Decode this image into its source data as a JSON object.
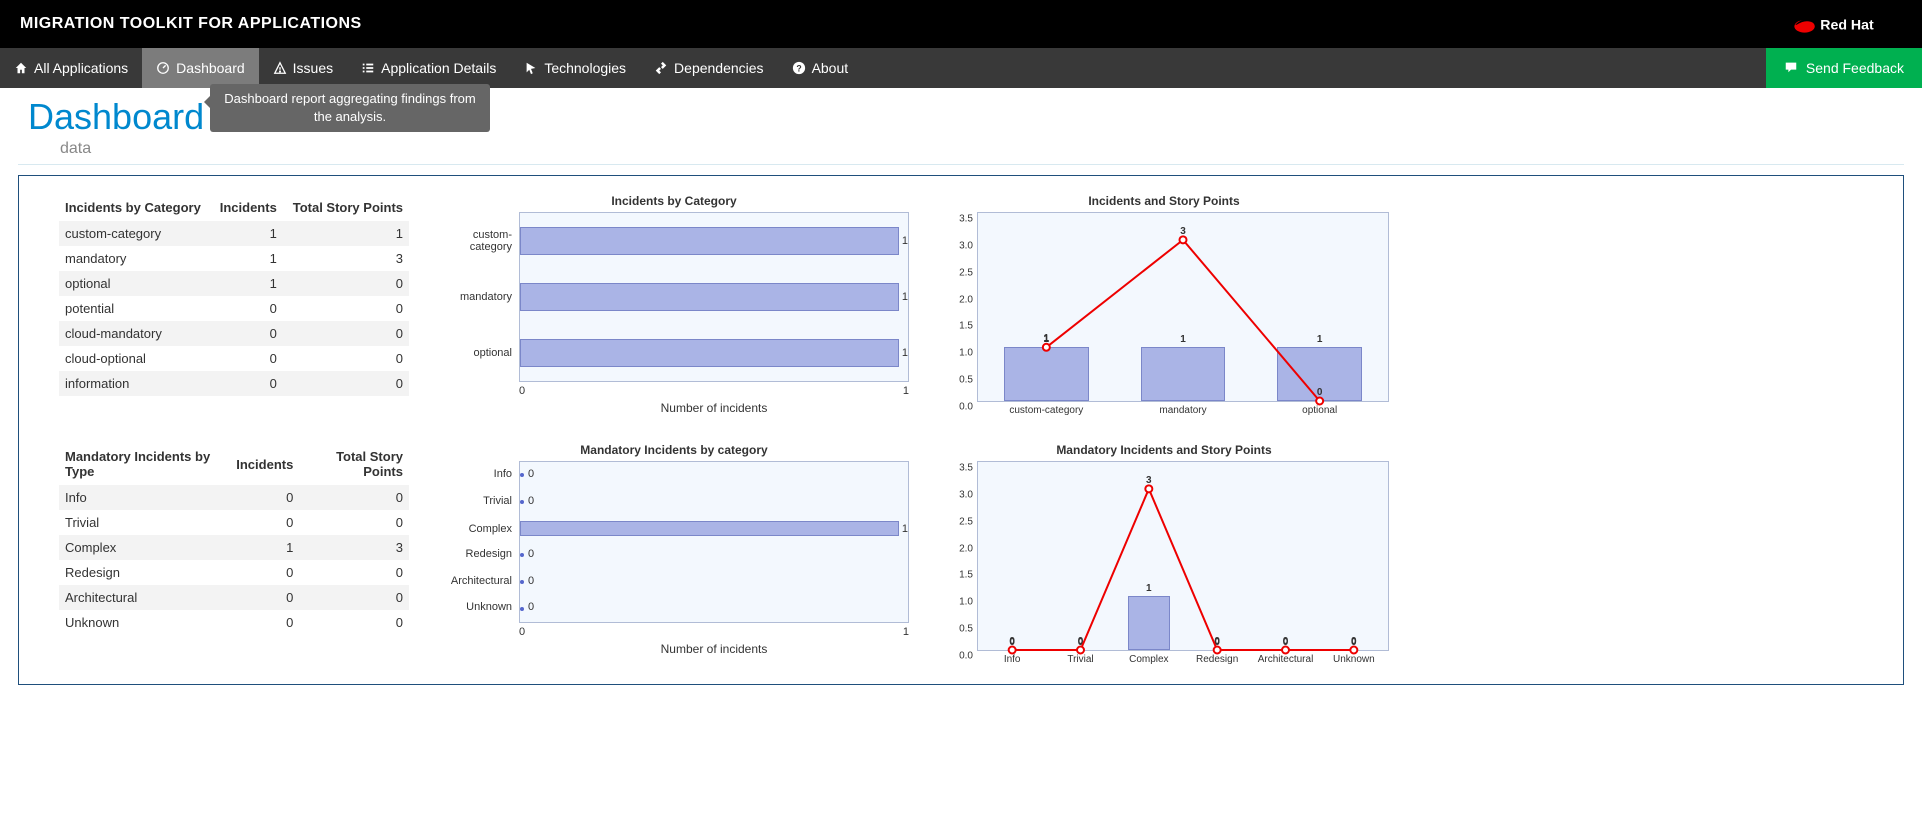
{
  "header": {
    "app_title": "MIGRATION TOOLKIT FOR APPLICATIONS",
    "brand": "Red Hat"
  },
  "nav": {
    "all_apps": "All Applications",
    "dashboard": "Dashboard",
    "issues": "Issues",
    "app_details": "Application Details",
    "technologies": "Technologies",
    "dependencies": "Dependencies",
    "about": "About",
    "feedback": "Send Feedback"
  },
  "page": {
    "title": "Dashboard",
    "tooltip": "Dashboard report aggregating findings from the analysis.",
    "subtitle": "data"
  },
  "tables": {
    "t1": {
      "headers": [
        "Incidents by Category",
        "Incidents",
        "Total Story Points"
      ],
      "rows": [
        {
          "c0": "custom-category",
          "c1": "1",
          "c2": "1"
        },
        {
          "c0": "mandatory",
          "c1": "1",
          "c2": "3"
        },
        {
          "c0": "optional",
          "c1": "1",
          "c2": "0"
        },
        {
          "c0": "potential",
          "c1": "0",
          "c2": "0"
        },
        {
          "c0": "cloud-mandatory",
          "c1": "0",
          "c2": "0"
        },
        {
          "c0": "cloud-optional",
          "c1": "0",
          "c2": "0"
        },
        {
          "c0": "information",
          "c1": "0",
          "c2": "0"
        }
      ]
    },
    "t2": {
      "headers": [
        "Mandatory Incidents by Type",
        "Incidents",
        "Total Story Points"
      ],
      "rows": [
        {
          "c0": "Info",
          "c1": "0",
          "c2": "0"
        },
        {
          "c0": "Trivial",
          "c1": "0",
          "c2": "0"
        },
        {
          "c0": "Complex",
          "c1": "1",
          "c2": "3"
        },
        {
          "c0": "Redesign",
          "c1": "0",
          "c2": "0"
        },
        {
          "c0": "Architectural",
          "c1": "0",
          "c2": "0"
        },
        {
          "c0": "Unknown",
          "c1": "0",
          "c2": "0"
        }
      ]
    }
  },
  "chart_data": [
    {
      "id": "chart1",
      "type": "bar",
      "orientation": "horizontal",
      "title": "Incidents by Category",
      "xlabel": "Number of incidents",
      "categories": [
        "custom-category",
        "mandatory",
        "optional"
      ],
      "values": [
        1,
        1,
        1
      ],
      "xlim": [
        0,
        1
      ]
    },
    {
      "id": "chart2",
      "type": "bar+line",
      "title": "Incidents and Story Points",
      "categories": [
        "custom-category",
        "mandatory",
        "optional"
      ],
      "series": [
        {
          "name": "Incidents",
          "style": "bar",
          "values": [
            1,
            1,
            1
          ]
        },
        {
          "name": "Story Points",
          "style": "line",
          "values": [
            1,
            3,
            0
          ]
        }
      ],
      "ylim": [
        0,
        3.5
      ],
      "yticks": [
        0.0,
        0.5,
        1.0,
        1.5,
        2.0,
        2.5,
        3.0,
        3.5
      ]
    },
    {
      "id": "chart3",
      "type": "bar",
      "orientation": "horizontal",
      "title": "Mandatory Incidents by category",
      "xlabel": "Number of incidents",
      "categories": [
        "Info",
        "Trivial",
        "Complex",
        "Redesign",
        "Architectural",
        "Unknown"
      ],
      "values": [
        0,
        0,
        1,
        0,
        0,
        0
      ],
      "xlim": [
        0,
        1
      ]
    },
    {
      "id": "chart4",
      "type": "bar+line",
      "title": "Mandatory Incidents and Story Points",
      "categories": [
        "Info",
        "Trivial",
        "Complex",
        "Redesign",
        "Architectural",
        "Unknown"
      ],
      "series": [
        {
          "name": "Incidents",
          "style": "bar",
          "values": [
            0,
            0,
            1,
            0,
            0,
            0
          ]
        },
        {
          "name": "Story Points",
          "style": "line",
          "values": [
            0,
            0,
            3,
            0,
            0,
            0
          ]
        }
      ],
      "ylim": [
        0,
        3.5
      ],
      "yticks": [
        0.0,
        0.5,
        1.0,
        1.5,
        2.0,
        2.5,
        3.0,
        3.5
      ]
    }
  ]
}
